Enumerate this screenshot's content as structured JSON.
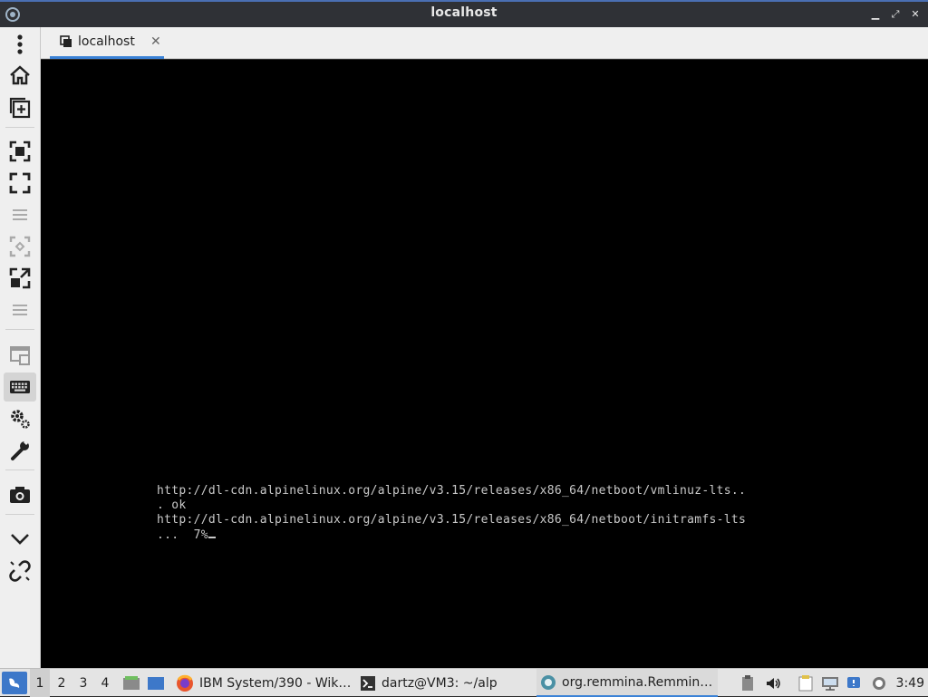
{
  "window": {
    "title": "localhost",
    "buttons": [
      "minimize",
      "restore",
      "close"
    ]
  },
  "toolbar": {
    "items": [
      {
        "name": "menu-icon"
      },
      {
        "name": "home-icon"
      },
      {
        "name": "new-connection-icon"
      },
      {
        "name": "fit-window-icon"
      },
      {
        "name": "fullscreen-icon"
      },
      {
        "name": "scaled-mode-icon"
      },
      {
        "name": "dynamic-resolution-icon"
      },
      {
        "name": "multi-monitor-icon"
      },
      {
        "name": "keyboard-grab-icon"
      },
      {
        "name": "preferences-icon"
      },
      {
        "name": "tools-icon"
      },
      {
        "name": "screenshot-icon"
      },
      {
        "name": "minimize-toolbar-icon"
      },
      {
        "name": "disconnect-icon"
      }
    ]
  },
  "tab": {
    "label": "localhost",
    "close": "✕"
  },
  "console": {
    "line1": "http://dl-cdn.alpinelinux.org/alpine/v3.15/releases/x86_64/netboot/vmlinuz-lts..",
    "line2": ". ok",
    "line3": "http://dl-cdn.alpinelinux.org/alpine/v3.15/releases/x86_64/netboot/initramfs-lts",
    "line4": "...  7%"
  },
  "taskbar": {
    "workspaces": [
      "1",
      "2",
      "3",
      "4"
    ],
    "tasks": [
      {
        "label": "IBM System/390 - Wik…",
        "icon": "firefox-icon"
      },
      {
        "label": "dartz@VM3: ~/alp",
        "icon": "terminal-icon"
      },
      {
        "label": "org.remmina.Remmin…",
        "icon": "remmina-icon",
        "active": true
      }
    ],
    "clock": "3:49"
  },
  "colors": {
    "accent": "#3b82d6",
    "titlebar": "#2f3136",
    "screen": "#000000"
  }
}
